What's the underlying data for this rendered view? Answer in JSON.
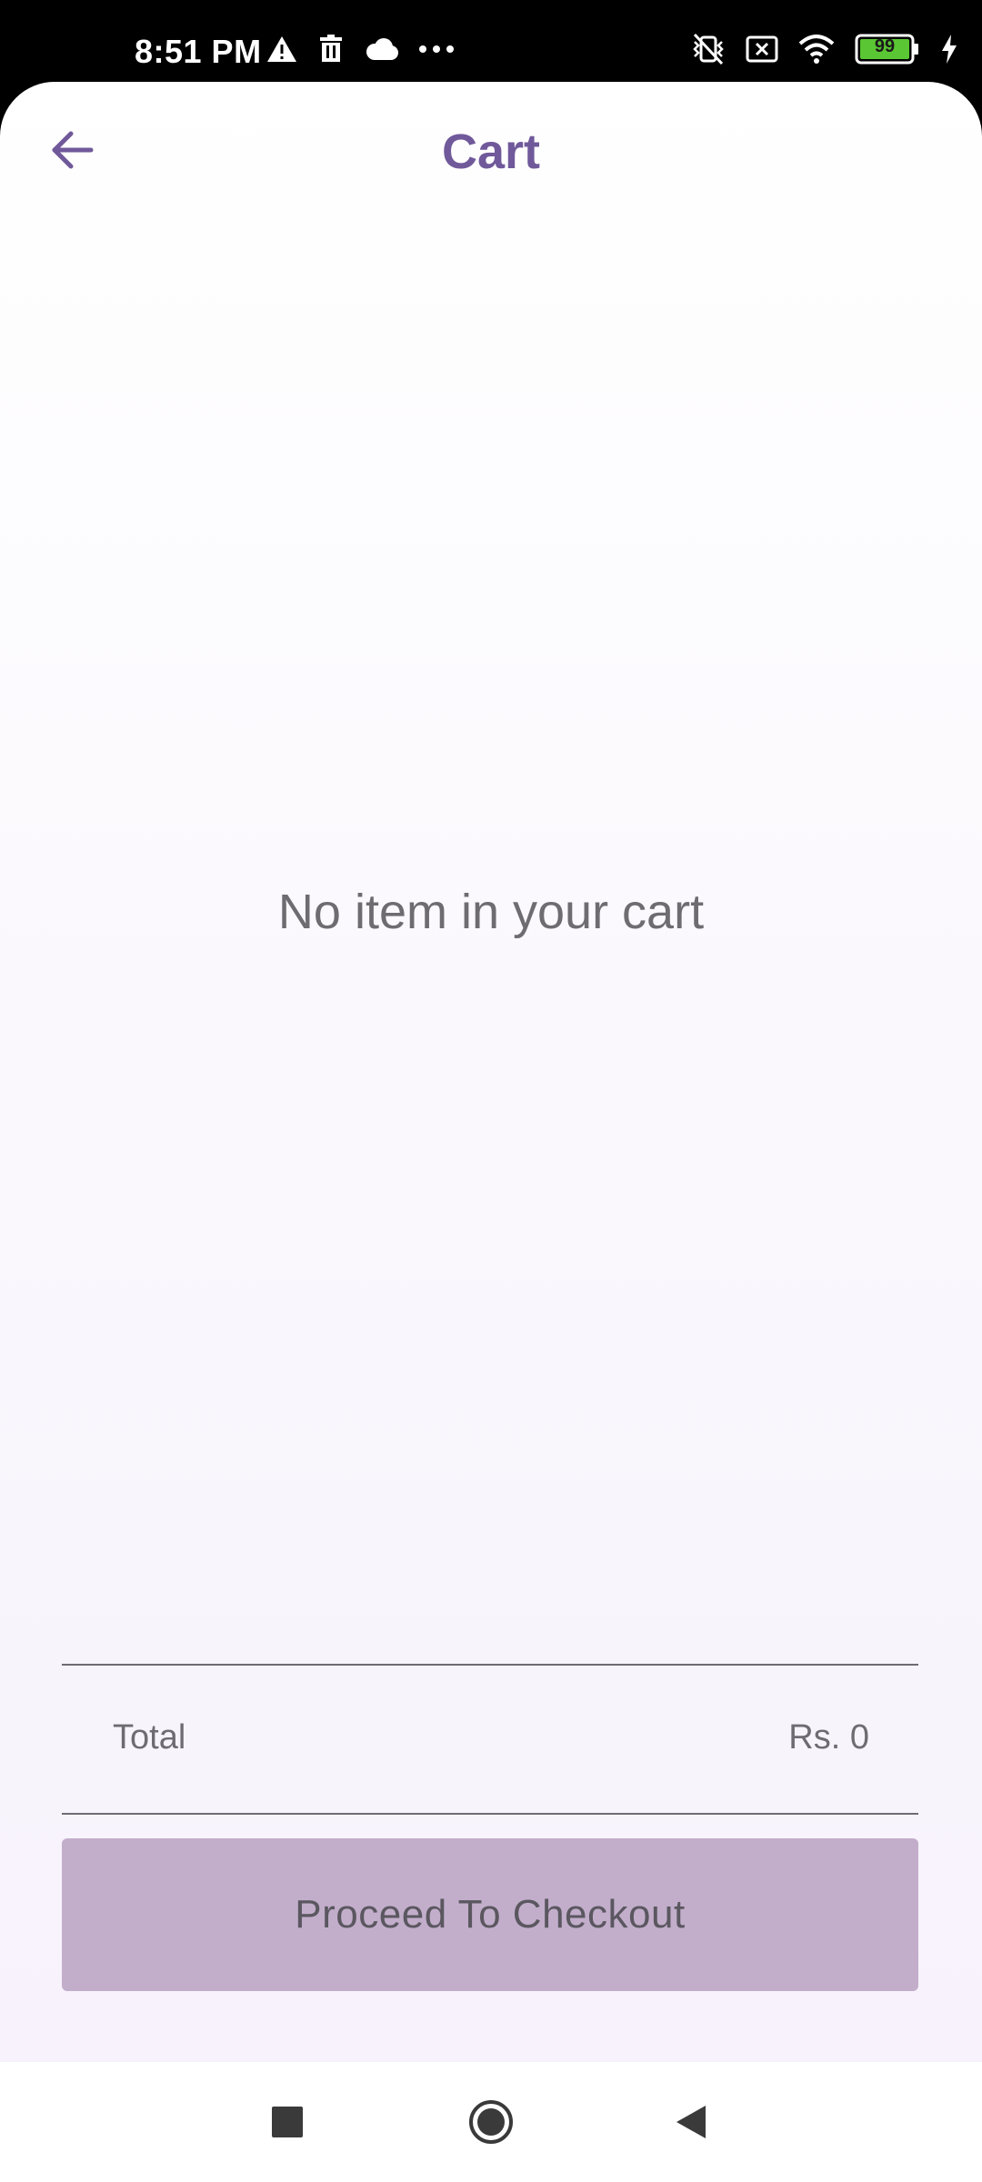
{
  "status_bar": {
    "time": "8:51 PM",
    "battery": "99",
    "left_icons": [
      "warning-icon",
      "trash-icon",
      "cloud-icon",
      "more-dots-icon"
    ],
    "right_icons": [
      "vibrate-off-icon",
      "sim-x-icon",
      "wifi-icon",
      "battery-icon",
      "charging-icon"
    ]
  },
  "header": {
    "title": "Cart",
    "back_icon": "arrow-left-icon"
  },
  "main": {
    "empty_message": "No item in your cart"
  },
  "summary": {
    "total_label": "Total",
    "total_value": "Rs. 0"
  },
  "checkout": {
    "label": "Proceed To Checkout"
  },
  "nav_bar": {
    "icons": [
      "recents-square-icon",
      "home-circle-icon",
      "back-triangle-icon"
    ]
  },
  "colors": {
    "accent": "#70599a",
    "button_bg": "#c2aecb",
    "battery_green": "#5ac633"
  }
}
